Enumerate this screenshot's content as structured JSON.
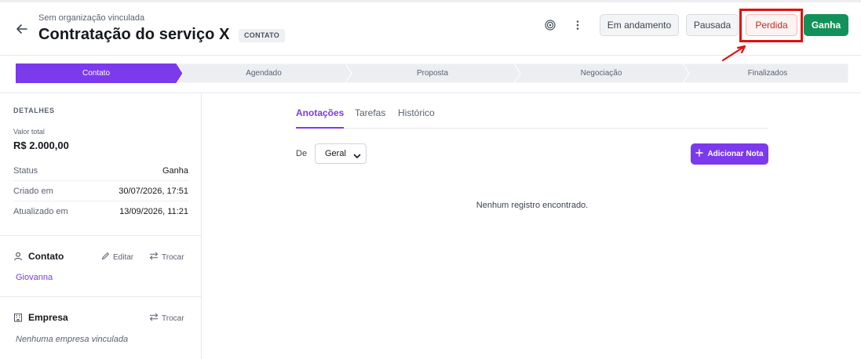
{
  "header": {
    "organization": "Sem organização vinculada",
    "title": "Contratação do serviço X",
    "stage_badge": "CONTATO",
    "status_buttons": {
      "em_andamento": "Em andamento",
      "pausada": "Pausada",
      "perdida": "Perdida",
      "ganha": "Ganha"
    }
  },
  "pipeline": {
    "steps": [
      "Contato",
      "Agendado",
      "Proposta",
      "Negociação",
      "Finalizados"
    ],
    "active_index": 0
  },
  "details": {
    "section_title": "DETALHES",
    "total_label": "Valor total",
    "total_value": "R$ 2.000,00",
    "rows": [
      {
        "label": "Status",
        "value": "Ganha"
      },
      {
        "label": "Criado em",
        "value": "30/07/2026, 17:51"
      },
      {
        "label": "Atualizado em",
        "value": "13/09/2026, 11:21"
      }
    ]
  },
  "contact": {
    "title": "Contato",
    "edit_label": "Editar",
    "swap_label": "Trocar",
    "name": "Giovanna"
  },
  "company": {
    "title": "Empresa",
    "swap_label": "Trocar",
    "empty_text": "Nenhuma empresa vinculada"
  },
  "main": {
    "tabs": [
      "Anotações",
      "Tarefas",
      "Histórico"
    ],
    "active_tab": 0,
    "filter_label": "De",
    "filter_value": "Geral",
    "add_button": "Adicionar Nota",
    "empty_text": "Nenhum registro encontrado."
  },
  "colors": {
    "accent": "#7c3aed",
    "success": "#12925a",
    "danger": "#c62828",
    "annotation": "#e01010"
  },
  "icons": [
    "arrow-left-icon",
    "target-icon",
    "more-vertical-icon",
    "user-icon",
    "pencil-icon",
    "swap-icon",
    "building-icon",
    "plus-icon",
    "chevron-down-icon",
    "annotation-arrow-icon"
  ]
}
